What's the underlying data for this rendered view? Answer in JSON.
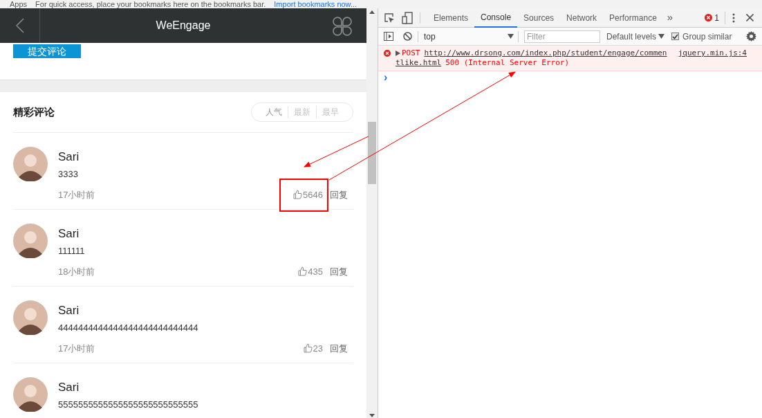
{
  "bookmarks_bar": {
    "apps_label": "Apps",
    "hint": "For quick access, place your bookmarks here on the bookmarks bar.",
    "import_link": "Import bookmarks now..."
  },
  "page": {
    "title": "WeEngage",
    "submit_button": "提交评论",
    "section_title": "精彩评论",
    "sort_options": [
      {
        "label": "人气",
        "selected": true
      },
      {
        "label": "最新",
        "selected": false
      },
      {
        "label": "最早",
        "selected": false
      }
    ],
    "comments": [
      {
        "author": "Sari",
        "text": "3333",
        "time": "17小时前",
        "likes": "5646",
        "reply": "回复",
        "highlighted": true
      },
      {
        "author": "Sari",
        "text": "111111",
        "time": "18小时前",
        "likes": "435",
        "reply": "回复",
        "highlighted": false
      },
      {
        "author": "Sari",
        "text": "4444444444444444444444444444",
        "time": "17小时前",
        "likes": "23",
        "reply": "回复",
        "highlighted": false
      },
      {
        "author": "Sari",
        "text": "5555555555555555555555555555"
      }
    ]
  },
  "devtools": {
    "tabs": [
      {
        "label": "Elements",
        "selected": false
      },
      {
        "label": "Console",
        "selected": true
      },
      {
        "label": "Sources",
        "selected": false
      },
      {
        "label": "Network",
        "selected": false
      },
      {
        "label": "Performance",
        "selected": false
      }
    ],
    "more_tabs": "»",
    "error_count": "1",
    "context": "top",
    "filter_placeholder": "Filter",
    "levels": "Default levels",
    "group_similar": {
      "label": "Group similar",
      "checked": true
    },
    "messages": [
      {
        "method": "POST",
        "url_part1": "http://www.drsong.com/index.php/student/engage/commen",
        "url_part2": "tlike.html",
        "status": "500 (Internal Server Error)",
        "source": "jquery.min.js:4"
      }
    ],
    "prompt": "›"
  }
}
